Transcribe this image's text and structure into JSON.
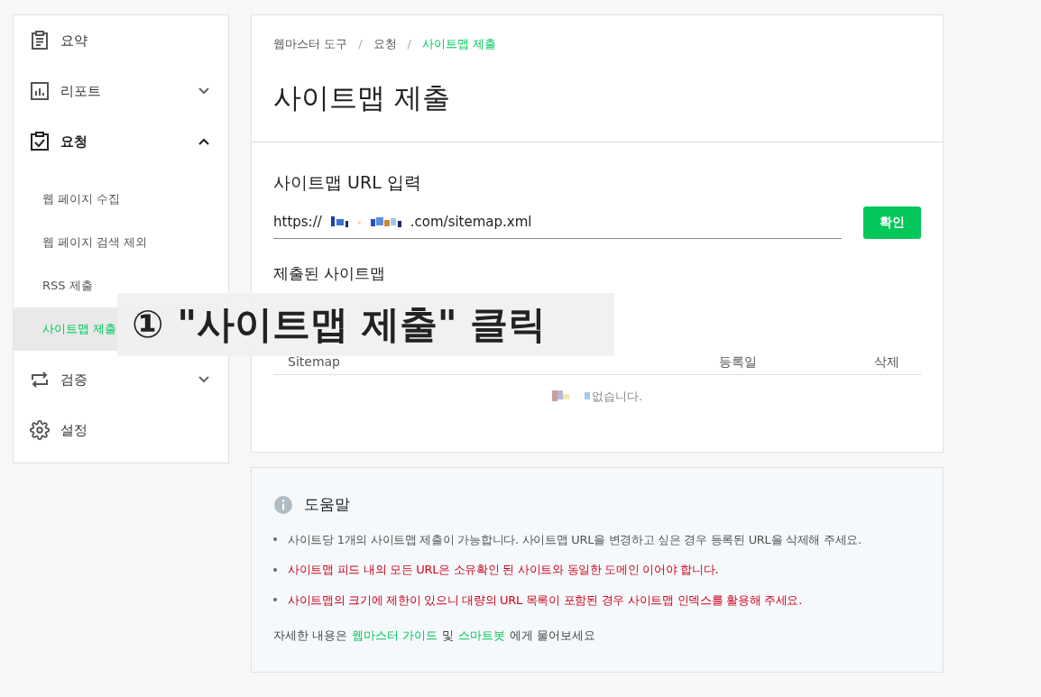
{
  "sidebar": {
    "items": [
      {
        "label": "요약",
        "kind": "summary"
      },
      {
        "label": "리포트",
        "kind": "report",
        "expanded": false
      },
      {
        "label": "요청",
        "kind": "request",
        "expanded": true,
        "children": [
          {
            "label": "웹 페이지 수집",
            "selected": false
          },
          {
            "label": "웹 페이지 검색 제외",
            "selected": false
          },
          {
            "label": "RSS 제출",
            "selected": false
          },
          {
            "label": "사이트맵 제출",
            "selected": true
          }
        ]
      },
      {
        "label": "검증",
        "kind": "verify",
        "expanded": false
      },
      {
        "label": "설정",
        "kind": "settings"
      }
    ]
  },
  "breadcrumb": [
    "웹마스터 도구",
    "요청",
    "사이트맵 제출"
  ],
  "breadcrumb_separator": "/",
  "title": "사이트맵 제출",
  "url_form": {
    "label": "사이트맵 URL 입력",
    "value_start": "https://",
    "value_end": ".com/sitemap.xml",
    "button": "확인"
  },
  "submitted": {
    "heading": "제출된 사이트맵",
    "columns": [
      "Sitemap",
      "등록일",
      "삭제"
    ],
    "empty_text": "없습니다."
  },
  "help": {
    "title": "도움말",
    "bullets": [
      {
        "text": "사이트당 1개의 사이트맵 제출이 가능합니다. 사이트맵 URL을 변경하고 싶은 경우 등록된 URL을 삭제해 주세요.",
        "color": "#555555"
      },
      {
        "text": "사이트맵 피드 내의 모든 URL은 소유확인 된 사이트와 동일한 도메인 이어야 합니다.",
        "color": "#d0021b"
      },
      {
        "text": "사이트맵의 크기에 제한이 있으니 대량의 URL 목록이 포함된 경우 사이트맵 인덱스를 활용해 주세요.",
        "color": "#d0021b"
      }
    ],
    "footer": [
      {
        "kind": "text",
        "text": "자세한 내용은"
      },
      {
        "kind": "link",
        "text": "웹마스터 가이드"
      },
      {
        "kind": "text",
        "text": "및"
      },
      {
        "kind": "link",
        "text": "스마트봇"
      },
      {
        "kind": "text",
        "text": "에게 물어보세요"
      }
    ]
  },
  "callout": "① \"사이트맵 제출\" 클릭"
}
